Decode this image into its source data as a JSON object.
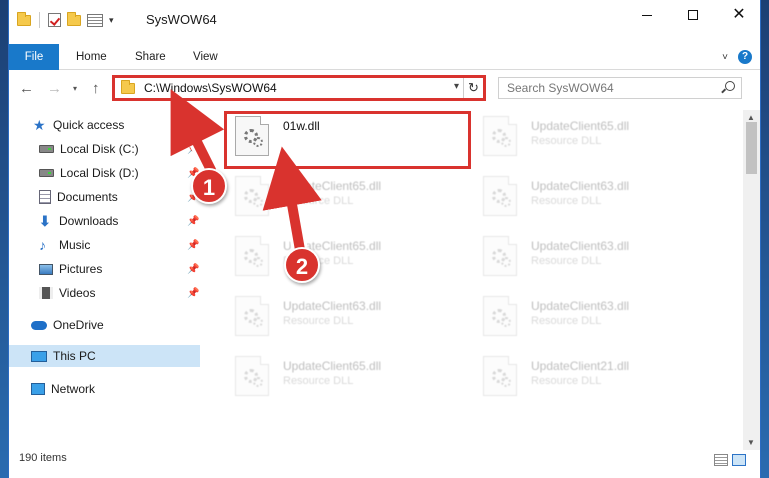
{
  "window": {
    "title": "SysWOW64"
  },
  "ribbon": {
    "tabs": [
      "File",
      "Home",
      "Share",
      "View"
    ],
    "help_icon": "?"
  },
  "address_bar": {
    "path": "C:\\Windows\\SysWOW64"
  },
  "search": {
    "placeholder": "Search SysWOW64"
  },
  "sidebar": {
    "items": [
      {
        "label": "Quick access",
        "icon": "star-icon"
      },
      {
        "label": "Local Disk (C:)",
        "icon": "drive-icon",
        "pinned": true
      },
      {
        "label": "Local Disk (D:)",
        "icon": "drive-icon",
        "pinned": true
      },
      {
        "label": "Documents",
        "icon": "documents-icon",
        "pinned": true
      },
      {
        "label": "Downloads",
        "icon": "downloads-icon",
        "pinned": true
      },
      {
        "label": "Music",
        "icon": "music-icon",
        "pinned": true
      },
      {
        "label": "Pictures",
        "icon": "pictures-icon",
        "pinned": true
      },
      {
        "label": "Videos",
        "icon": "videos-icon",
        "pinned": true
      },
      {
        "label": "OneDrive",
        "icon": "onedrive-icon"
      },
      {
        "label": "This PC",
        "icon": "pc-icon",
        "selected": true
      },
      {
        "label": "Network",
        "icon": "network-icon"
      }
    ]
  },
  "files": [
    {
      "name": "01w.dll",
      "type": "",
      "highlighted": true
    },
    {
      "name": "UpdateClient65.dll",
      "type": "Resource DLL"
    },
    {
      "name": "UpdateClient65.dll",
      "type": "Resource DLL"
    },
    {
      "name": "UpdateClient63.dll",
      "type": "Resource DLL"
    },
    {
      "name": "UpdateClient65.dll",
      "type": "Resource DLL"
    },
    {
      "name": "UpdateClient63.dll",
      "type": "Resource DLL"
    },
    {
      "name": "UpdateClient63.dll",
      "type": "Resource DLL"
    },
    {
      "name": "UpdateClient63.dll",
      "type": "Resource DLL"
    },
    {
      "name": "UpdateClient65.dll",
      "type": "Resource DLL"
    },
    {
      "name": "UpdateClient21.dll",
      "type": "Resource DLL"
    }
  ],
  "status_bar": {
    "item_count": "190 items"
  },
  "annotations": {
    "step1": "1",
    "step2": "2",
    "color": "#d9332e"
  }
}
